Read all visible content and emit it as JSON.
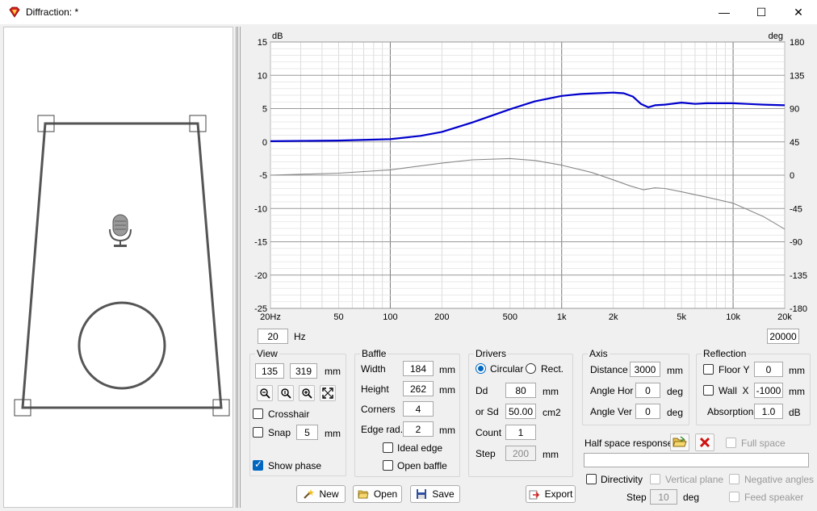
{
  "window": {
    "title": "Diffraction: *",
    "min": "—",
    "max": "☐",
    "close": "✕"
  },
  "chart_data": {
    "type": "line",
    "x_scale": "log",
    "xlim": [
      20,
      20000
    ],
    "ylim_left": [
      -25,
      15
    ],
    "ylim_right": [
      -180,
      180
    ],
    "ylabel_left": "dB",
    "ylabel_right": "deg",
    "grid": true,
    "x_ticks": [
      {
        "v": 20,
        "label": "20Hz"
      },
      {
        "v": 50,
        "label": "50"
      },
      {
        "v": 100,
        "label": "100"
      },
      {
        "v": 200,
        "label": "200"
      },
      {
        "v": 500,
        "label": "500"
      },
      {
        "v": 1000,
        "label": "1k"
      },
      {
        "v": 2000,
        "label": "2k"
      },
      {
        "v": 5000,
        "label": "5k"
      },
      {
        "v": 10000,
        "label": "10k"
      },
      {
        "v": 20000,
        "label": "20k"
      }
    ],
    "y_ticks_left": [
      15,
      10,
      5,
      0,
      -5,
      -10,
      -15,
      -20,
      -25
    ],
    "y_ticks_right": [
      180,
      135,
      90,
      45,
      0,
      -45,
      -90,
      -135,
      -180
    ],
    "series": [
      {
        "color": "#0000cc",
        "x": [
          20,
          50,
          100,
          150,
          200,
          300,
          500,
          700,
          1000,
          1300,
          1600,
          2000,
          2300,
          2600,
          2900,
          3200,
          3500,
          4000,
          5000,
          6000,
          7000,
          8000,
          10000,
          12000,
          15000,
          20000
        ],
        "y": [
          0.1,
          0.2,
          0.4,
          0.9,
          1.5,
          2.9,
          4.9,
          6.1,
          6.9,
          7.2,
          7.3,
          7.4,
          7.3,
          6.8,
          5.7,
          5.2,
          5.5,
          5.6,
          5.9,
          5.7,
          5.8,
          5.8,
          5.8,
          5.7,
          5.6,
          5.5
        ]
      },
      {
        "color": "#888888",
        "x": [
          20,
          50,
          100,
          200,
          300,
          500,
          700,
          1000,
          1500,
          2000,
          2500,
          3000,
          3500,
          4000,
          5000,
          7000,
          10000,
          15000,
          20000
        ],
        "y": [
          -5.0,
          -4.7,
          -4.2,
          -3.2,
          -2.7,
          -2.5,
          -2.8,
          -3.5,
          -4.6,
          -5.7,
          -6.6,
          -7.2,
          -6.9,
          -7.0,
          -7.5,
          -8.3,
          -9.2,
          -11.2,
          -13.1
        ]
      }
    ]
  },
  "range": {
    "min": "20",
    "unit": "Hz",
    "max": "20000"
  },
  "view": {
    "title": "View",
    "w": "135",
    "h": "319",
    "unit": "mm",
    "crosshair": "Crosshair",
    "snap": "Snap",
    "snap_value": "5",
    "snap_unit": "mm",
    "show_phase": "Show phase"
  },
  "baffle": {
    "title": "Baffle",
    "width_label": "Width",
    "width": "184",
    "height_label": "Height",
    "height": "262",
    "corners_label": "Corners",
    "corners": "4",
    "edge_label": "Edge rad.",
    "edge": "2",
    "unit": "mm",
    "ideal_edge": "Ideal edge",
    "open_baffle": "Open baffle"
  },
  "drivers": {
    "title": "Drivers",
    "circular": "Circular",
    "rect": "Rect.",
    "dd_label": "Dd",
    "dd": "80",
    "dd_unit": "mm",
    "sd_label": "or Sd",
    "sd": "50.00",
    "sd_unit": "cm2",
    "count_label": "Count",
    "count": "1",
    "step_label": "Step",
    "step": "200",
    "step_unit": "mm"
  },
  "axis": {
    "title": "Axis",
    "distance_label": "Distance",
    "distance": "3000",
    "distance_unit": "mm",
    "hor_label": "Angle Hor",
    "hor": "0",
    "ver_label": "Angle Ver",
    "ver": "0",
    "deg": "deg"
  },
  "reflection": {
    "title": "Reflection",
    "floor_label": "Floor Y",
    "floor": "0",
    "wall_label": "Wall  X",
    "wall": "-1000",
    "unit": "mm",
    "absorption_label": "Absorption",
    "absorption": "1.0",
    "absorption_unit": "dB"
  },
  "half_space": {
    "label": "Half space response",
    "full_space": "Full space",
    "path": ""
  },
  "directivity": {
    "label": "Directivity",
    "vertical_plane": "Vertical plane",
    "negative_angles": "Negative angles",
    "step_label": "Step",
    "step": "10",
    "step_unit": "deg",
    "feed_speaker": "Feed speaker"
  },
  "buttons": {
    "new": "New",
    "open": "Open",
    "save": "Save",
    "export": "Export"
  }
}
